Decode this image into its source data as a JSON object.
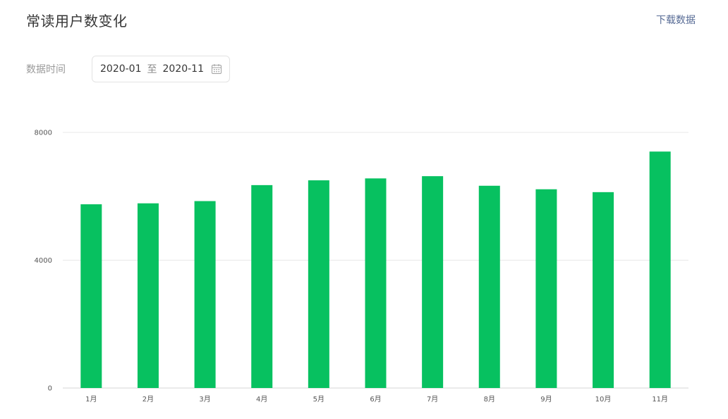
{
  "header": {
    "title": "常读用户数变化",
    "download_label": "下载数据"
  },
  "filter": {
    "label": "数据时间",
    "start": "2020-01",
    "separator": "至",
    "end": "2020-11",
    "calendar_icon": "calendar-icon"
  },
  "colors": {
    "bar": "#07c160",
    "grid": "#e8e8e8",
    "axis": "#d6d6d6",
    "link": "#576b95"
  },
  "chart_data": {
    "type": "bar",
    "categories": [
      "1月",
      "2月",
      "3月",
      "4月",
      "5月",
      "6月",
      "7月",
      "8月",
      "9月",
      "10月",
      "11月"
    ],
    "values": [
      5750,
      5780,
      5850,
      6350,
      6500,
      6560,
      6630,
      6330,
      6220,
      6130,
      7400
    ],
    "ylim": [
      0,
      8000
    ],
    "yticks": [
      0,
      4000,
      8000
    ],
    "grid": true,
    "legend": "none"
  }
}
